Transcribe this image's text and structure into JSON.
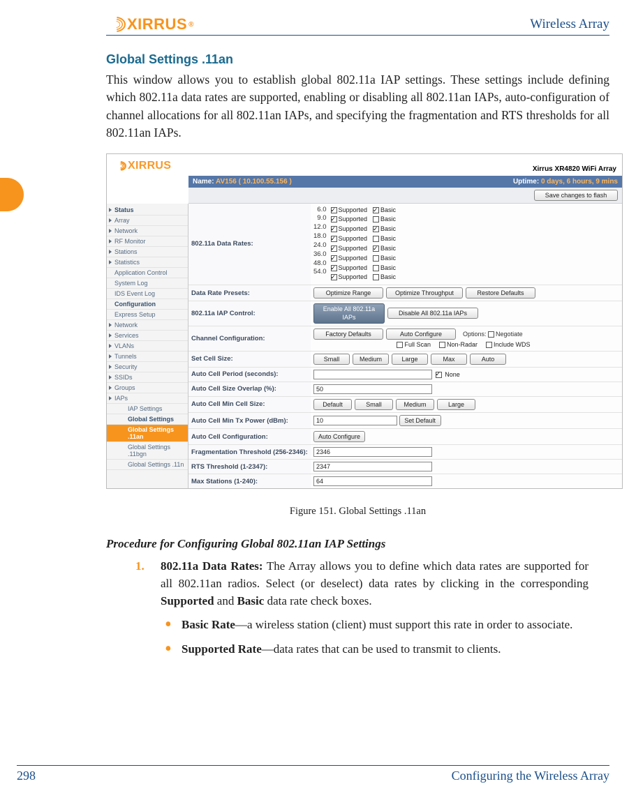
{
  "doc": {
    "header_right": "Wireless Array",
    "page_number": "298",
    "footer_section": "Configuring the Wireless Array",
    "logo_text": "XIRRUS",
    "logo_mark": "®"
  },
  "section": {
    "heading": "Global Settings .11an",
    "para1": "This window allows you to establish global 802.11a IAP settings. These settings include defining which 802.11a data rates are supported, enabling or disabling all 802.11an IAPs, auto-configuration of channel allocations for all 802.11an IAPs, and specifying the fragmentation and RTS thresholds for all 802.11an IAPs.",
    "figure_caption": "Figure 151. Global Settings .11an",
    "procedure_title": "Procedure for Configuring Global 802.11an IAP Settings",
    "step1_num": "1.",
    "step1_lead": "802.11a Data Rates:",
    "step1_text": " The Array allows you to define which data rates are supported for all 802.11an radios. Select (or deselect) data rates by clicking in the corresponding ",
    "step1_b1": "Supported",
    "step1_and": " and ",
    "step1_b2": "Basic",
    "step1_tail": " data rate check boxes.",
    "sub1_lead": "Basic Rate",
    "sub1_text": "—a wireless station (client) must support this rate in order to associate.",
    "sub2_lead": "Supported Rate",
    "sub2_text": "—data rates that can be used to transmit to clients."
  },
  "ui": {
    "header_model": "Xirrus XR4820 WiFi Array",
    "mini_logo": "XIRRUS",
    "name_label": "Name:",
    "name_value": "AV156   ( 10.100.55.156 )",
    "uptime_label": "Uptime:",
    "uptime_value": "0 days, 6 hours, 9 mins",
    "save_btn": "Save changes to flash",
    "menu": [
      {
        "label": "Status",
        "bold": true,
        "arrow": true
      },
      {
        "label": "Array",
        "arrow": true
      },
      {
        "label": "Network",
        "arrow": true
      },
      {
        "label": "RF Monitor",
        "arrow": true
      },
      {
        "label": "Stations",
        "arrow": true
      },
      {
        "label": "Statistics",
        "arrow": true
      },
      {
        "label": "Application Control",
        "arrow": false,
        "noarrow": true
      },
      {
        "label": "System Log",
        "arrow": false,
        "noarrow": true
      },
      {
        "label": "IDS Event Log",
        "arrow": false,
        "noarrow": true
      },
      {
        "label": "Configuration",
        "bold": true,
        "arrow": false,
        "noarrow": true
      },
      {
        "label": "Express Setup",
        "arrow": false,
        "noarrow": true
      },
      {
        "label": "Network",
        "arrow": true
      },
      {
        "label": "Services",
        "arrow": true
      },
      {
        "label": "VLANs",
        "arrow": true
      },
      {
        "label": "Tunnels",
        "arrow": true
      },
      {
        "label": "Security",
        "arrow": true
      },
      {
        "label": "SSIDs",
        "arrow": true
      },
      {
        "label": "Groups",
        "arrow": true
      },
      {
        "label": "IAPs",
        "arrow": true
      },
      {
        "label": "IAP Settings",
        "sub2": true,
        "noarrow": true
      },
      {
        "label": "Global Settings",
        "sub2": true,
        "noarrow": true,
        "bold": true
      },
      {
        "label": "Global Settings .11an",
        "sub2": true,
        "noarrow": true,
        "active": true,
        "bold": true
      },
      {
        "label": "Global Settings .11bgn",
        "sub2": true,
        "noarrow": true
      },
      {
        "label": "Global Settings .11n",
        "sub2": true,
        "noarrow": true
      }
    ],
    "rates_label": "802.11a Data Rates:",
    "rates": [
      {
        "v": "6.0",
        "sup": true,
        "bas": true
      },
      {
        "v": "9.0",
        "sup": true,
        "bas": false
      },
      {
        "v": "12.0",
        "sup": true,
        "bas": true
      },
      {
        "v": "18.0",
        "sup": true,
        "bas": false
      },
      {
        "v": "24.0",
        "sup": true,
        "bas": true
      },
      {
        "v": "36.0",
        "sup": true,
        "bas": false
      },
      {
        "v": "48.0",
        "sup": true,
        "bas": false
      },
      {
        "v": "54.0",
        "sup": true,
        "bas": false
      }
    ],
    "supported_word": "Supported",
    "basic_word": "Basic",
    "rows": {
      "presets": {
        "label": "Data Rate Presets:",
        "b1": "Optimize Range",
        "b2": "Optimize Throughput",
        "b3": "Restore Defaults"
      },
      "iapctrl": {
        "label": "802.11a IAP Control:",
        "b1": "Enable All 802.11a IAPs",
        "b2": "Disable All 802.11a IAPs"
      },
      "chan": {
        "label": "Channel Configuration:",
        "b1": "Factory Defaults",
        "b2": "Auto Configure",
        "opt": "Options:",
        "c1": "Negotiate",
        "c2": "Full Scan",
        "c3": "Non-Radar",
        "c4": "Include WDS"
      },
      "cell": {
        "label": "Set Cell Size:",
        "b": [
          "Small",
          "Medium",
          "Large",
          "Max",
          "Auto"
        ]
      },
      "period": {
        "label": "Auto Cell Period (seconds):",
        "none": "None"
      },
      "overlap": {
        "label": "Auto Cell Size Overlap (%):",
        "val": "50"
      },
      "minsize": {
        "label": "Auto Cell Min Cell Size:",
        "b": [
          "Default",
          "Small",
          "Medium",
          "Large"
        ]
      },
      "mintx": {
        "label": "Auto Cell Min Tx Power (dBm):",
        "val": "10",
        "btn": "Set Default"
      },
      "autoconf": {
        "label": "Auto Cell Configuration:",
        "btn": "Auto Configure"
      },
      "frag": {
        "label": "Fragmentation Threshold (256-2346):",
        "val": "2346"
      },
      "rts": {
        "label": "RTS Threshold (1-2347):",
        "val": "2347"
      },
      "max": {
        "label": "Max Stations (1-240):",
        "val": "64"
      }
    }
  }
}
